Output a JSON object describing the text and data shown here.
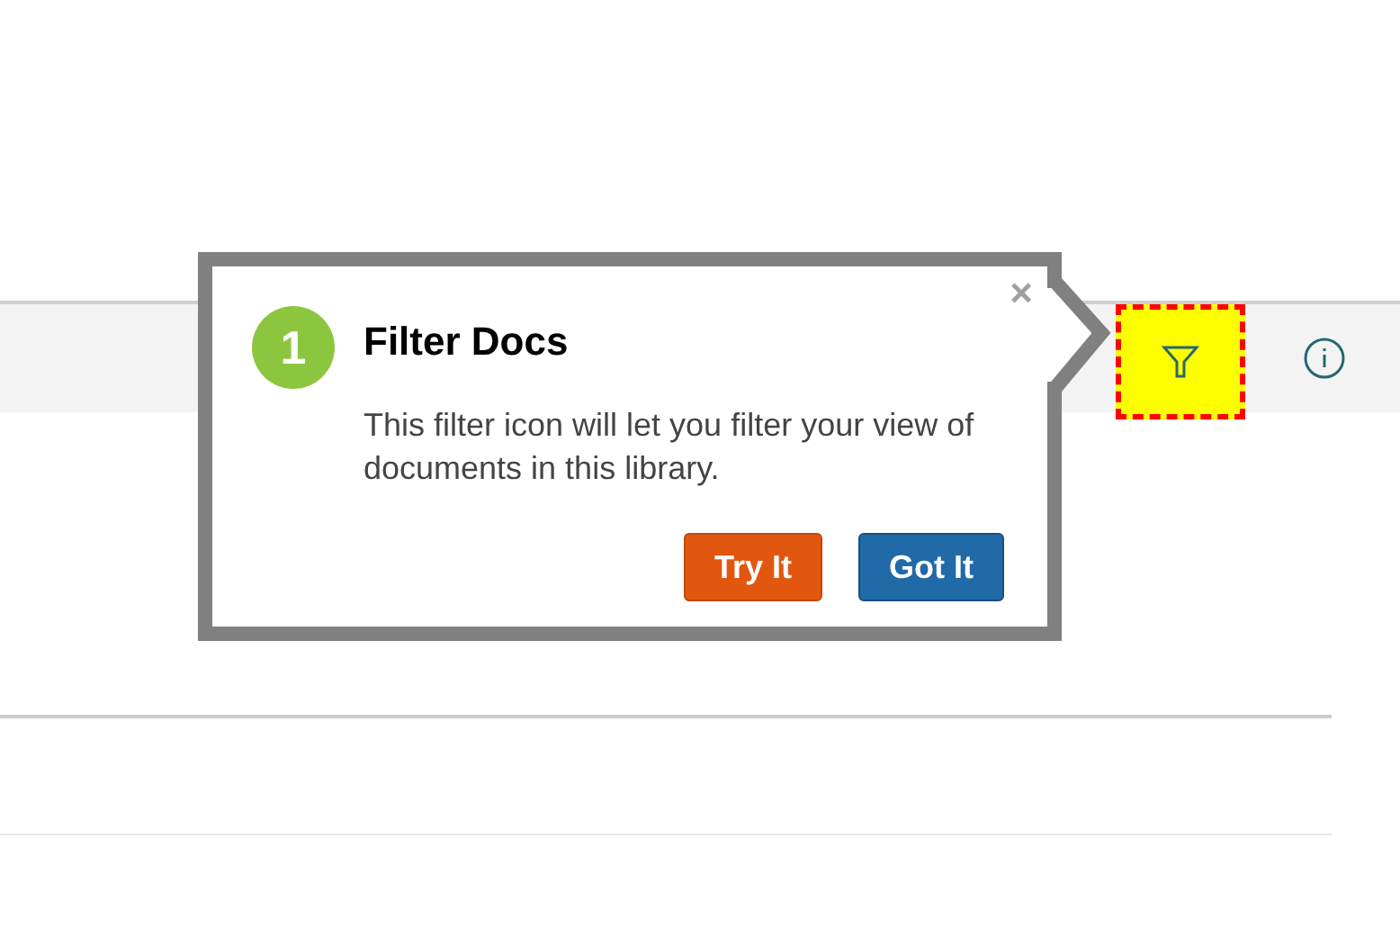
{
  "toolbar": {
    "filter_highlighted": true
  },
  "tour": {
    "step": "1",
    "title": "Filter Docs",
    "text": "This filter icon will let you filter your view of documents in this library.",
    "close": "×",
    "buttons": [
      {
        "label": "Try It",
        "kind": "secondary"
      },
      {
        "label": "Got It",
        "kind": "primary"
      }
    ]
  }
}
